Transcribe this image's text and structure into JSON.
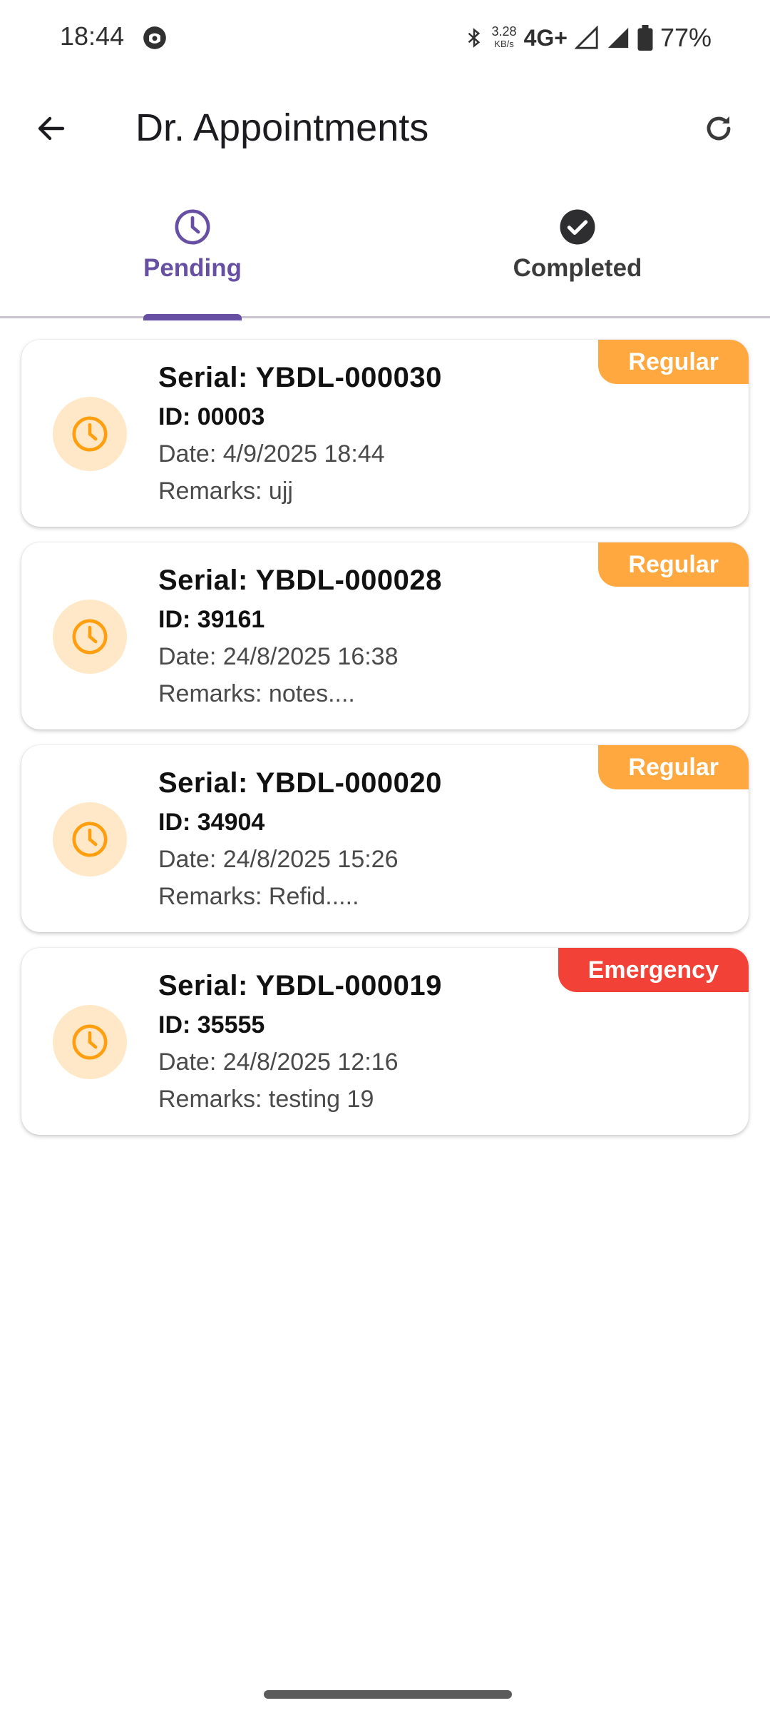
{
  "status_bar": {
    "time": "18:44",
    "speed_value": "3.28",
    "speed_unit": "KB/s",
    "network": "4G+",
    "battery": "77%"
  },
  "app_bar": {
    "title": "Dr. Appointments",
    "back_icon": "arrow-back-icon",
    "refresh_icon": "refresh-icon"
  },
  "tabs": [
    {
      "label": "Pending",
      "icon": "clock-icon",
      "selected": true
    },
    {
      "label": "Completed",
      "icon": "check-circle-icon",
      "selected": false
    }
  ],
  "colors": {
    "accent": "#6750a4",
    "regular_badge": "#ffa83f",
    "emergency_badge": "#f24137",
    "avatar_bg": "#ffe8c7",
    "avatar_icon": "#ff9f10"
  },
  "appointments": [
    {
      "serial": "Serial: YBDL-000030",
      "id": "ID: 00003",
      "date": "Date: 4/9/2025 18:44",
      "remarks": "Remarks: ujj",
      "badge": "Regular",
      "badge_type": "regular"
    },
    {
      "serial": "Serial: YBDL-000028",
      "id": "ID: 39161",
      "date": "Date: 24/8/2025 16:38",
      "remarks": "Remarks: notes....",
      "badge": "Regular",
      "badge_type": "regular"
    },
    {
      "serial": "Serial: YBDL-000020",
      "id": "ID: 34904",
      "date": "Date: 24/8/2025 15:26",
      "remarks": "Remarks: Refid.....",
      "badge": "Regular",
      "badge_type": "regular"
    },
    {
      "serial": "Serial: YBDL-000019",
      "id": "ID: 35555",
      "date": "Date: 24/8/2025 12:16",
      "remarks": "Remarks: testing 19",
      "badge": "Emergency",
      "badge_type": "emergency"
    }
  ]
}
